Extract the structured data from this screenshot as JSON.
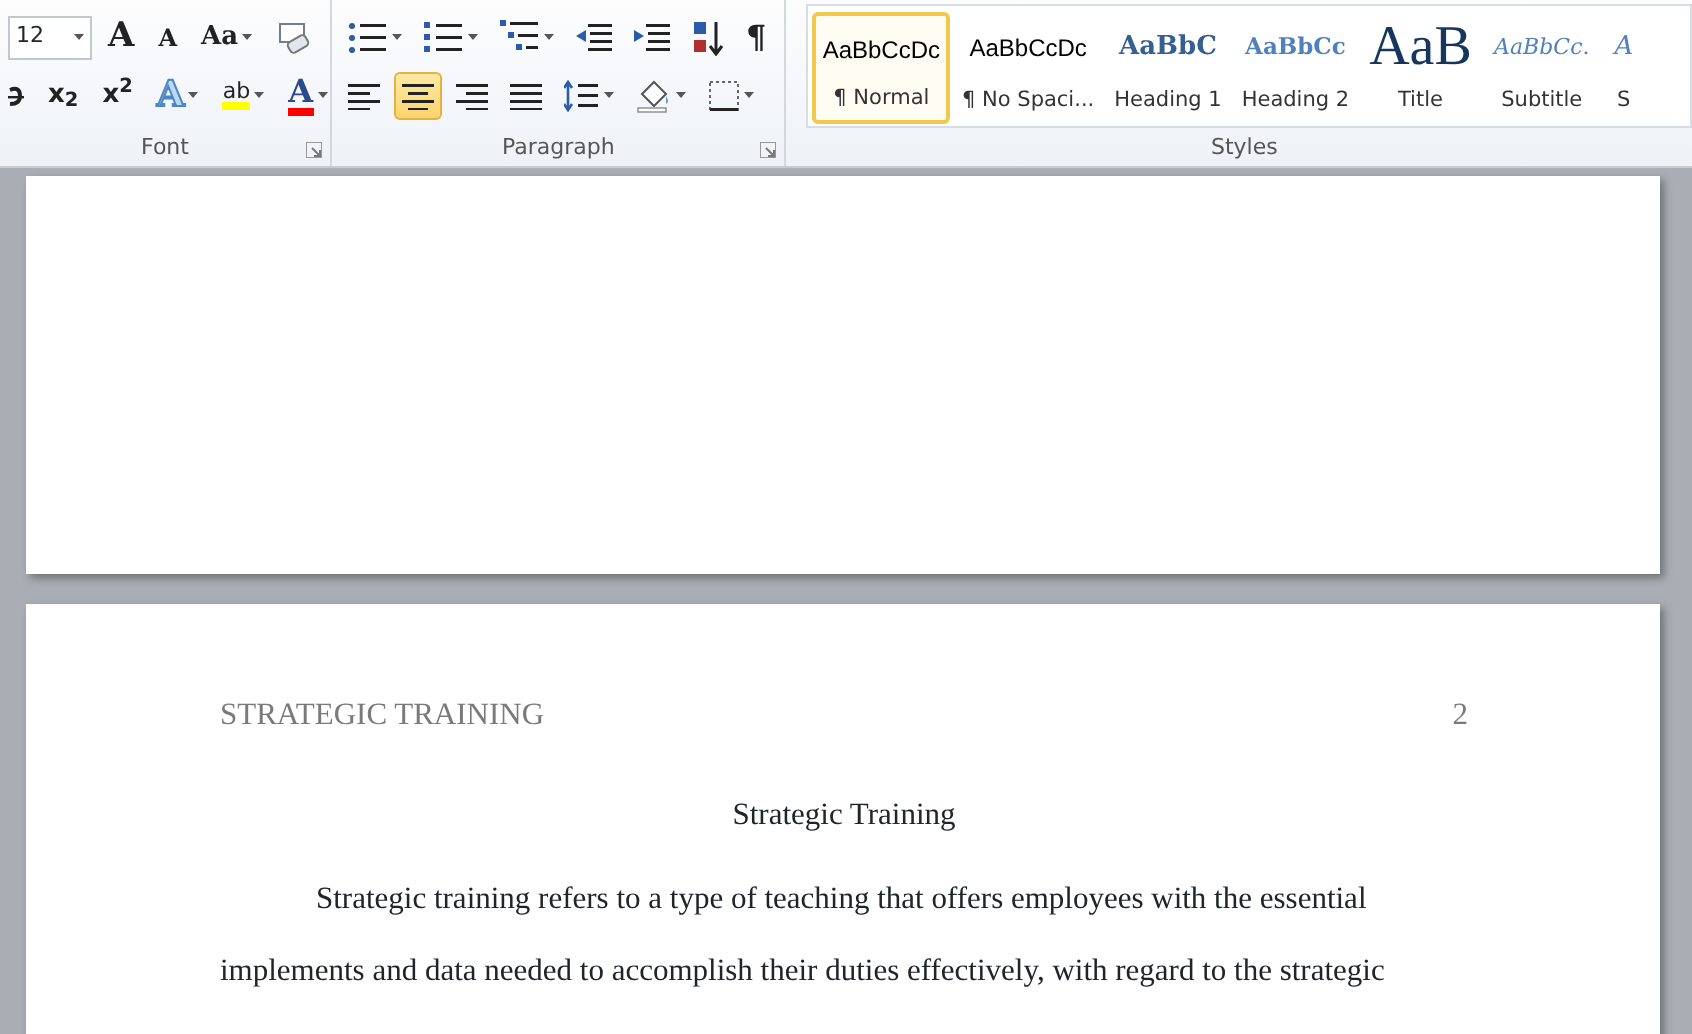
{
  "ribbon": {
    "font_group": {
      "label": "Font",
      "font_size": "12",
      "row1": [
        {
          "kind": "grow-font",
          "text": "A"
        },
        {
          "kind": "shrink-font",
          "text": "A"
        },
        {
          "kind": "change-case",
          "text": "Aa"
        },
        {
          "kind": "clear-formatting"
        }
      ],
      "row2": [
        {
          "kind": "strikethrough"
        },
        {
          "kind": "subscript",
          "text": "x$_{2}$"
        },
        {
          "kind": "superscript",
          "text": "x$^{2}$"
        },
        {
          "kind": "text-effects",
          "text": "A"
        },
        {
          "kind": "highlight",
          "text": "ab",
          "color": "#ffff00"
        },
        {
          "kind": "font-color",
          "text": "A",
          "color": "#ff0000"
        }
      ]
    },
    "paragraph_group": {
      "label": "Paragraph",
      "row1": [
        {
          "kind": "bullets"
        },
        {
          "kind": "numbering"
        },
        {
          "kind": "multilevel"
        },
        {
          "kind": "decrease-indent"
        },
        {
          "kind": "increase-indent"
        },
        {
          "kind": "sort"
        },
        {
          "kind": "pilcrow",
          "text": "¶"
        }
      ],
      "row2": [
        {
          "kind": "align-left",
          "selected": false
        },
        {
          "kind": "align-center",
          "selected": true
        },
        {
          "kind": "align-right",
          "selected": false
        },
        {
          "kind": "justify",
          "selected": false
        },
        {
          "kind": "line-spacing"
        },
        {
          "kind": "shading"
        },
        {
          "kind": "borders"
        }
      ]
    },
    "styles_group": {
      "label": "Styles",
      "items": [
        {
          "kind": "normal",
          "preview": "AaBbCcDc",
          "name": "¶ Normal",
          "selected": true
        },
        {
          "kind": "no-spacing",
          "preview": "AaBbCcDc",
          "name": "¶ No Spaci...",
          "selected": false
        },
        {
          "kind": "heading1",
          "preview": "AaBbC",
          "name": "Heading 1",
          "selected": false
        },
        {
          "kind": "heading2",
          "preview": "AaBbCc",
          "name": "Heading 2",
          "selected": false
        },
        {
          "kind": "title",
          "preview": "AaB",
          "name": "Title",
          "selected": false
        },
        {
          "kind": "subtitle",
          "preview": "AaBbCc.",
          "name": "Subtitle",
          "selected": false
        },
        {
          "kind": "partial",
          "preview": "A",
          "name": "S",
          "selected": false
        }
      ]
    }
  },
  "document": {
    "page_2": {
      "header": "STRATEGIC TRAINING",
      "page_number": "2",
      "title": "Strategic Training",
      "paragraph": "Strategic training refers to a type of teaching that offers employees with the essential implements and data needed to accomplish their duties effectively, with regard to the strategic"
    }
  }
}
